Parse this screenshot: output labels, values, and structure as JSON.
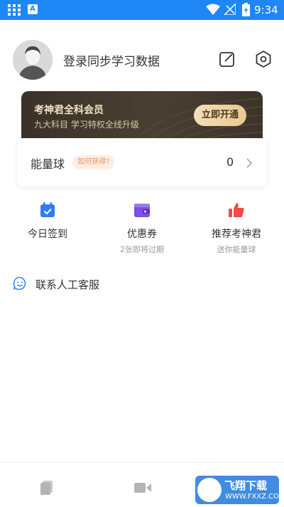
{
  "status_bar": {
    "time": "9:34",
    "icons": [
      "app-grid-icon",
      "a-notification-icon",
      "wifi-icon",
      "no-signal-icon",
      "battery-charging-icon"
    ],
    "app_badge": "A"
  },
  "profile": {
    "login_prompt": "登录同步学习数据",
    "avatar": "default-avatar",
    "icons": [
      "edit-icon",
      "settings-icon"
    ]
  },
  "vip_card": {
    "title": "考神君全科会员",
    "subtitle": "九大科目 学习特权全线升级",
    "button": "立即开通"
  },
  "energy": {
    "label": "能量球",
    "tag": "如何获得?",
    "count": "0"
  },
  "functions": [
    {
      "icon": "calendar-icon",
      "title": "今日签到",
      "sub": ""
    },
    {
      "icon": "wallet-coupon-icon",
      "title": "优惠券",
      "sub": "2张即将过期"
    },
    {
      "icon": "thumbs-up-icon",
      "title": "推荐考神君",
      "sub": "送你能量球"
    }
  ],
  "service": {
    "label": "联系人工客服",
    "icon": "smile-chat-icon"
  },
  "tabbar": {
    "tabs": [
      "book-tab-icon",
      "video-tab-icon"
    ]
  },
  "watermark": {
    "title": "飞翔下载",
    "url": "WWW.FXXZ.COM"
  },
  "colors": {
    "status_bar": "#1f86f5",
    "vip_card": "#3a3229",
    "vip_button": "#f4dfb8",
    "energy_tag_bg": "#fdeee4",
    "energy_tag_text": "#e9965c",
    "calendar": "#2f7cf6",
    "coupon": "#7b4fe0",
    "thumbs_up": "#f04a4a"
  }
}
